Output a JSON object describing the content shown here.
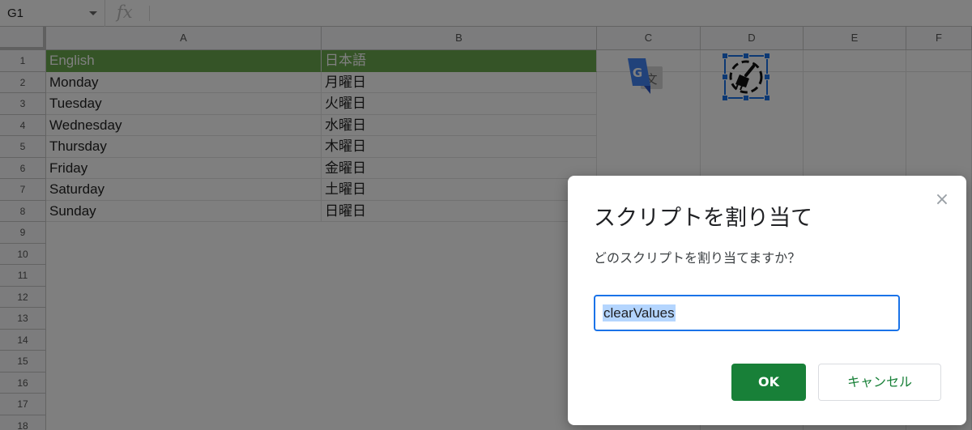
{
  "formula_bar": {
    "cell_ref": "G1",
    "fx_label": "fx",
    "formula": ""
  },
  "columns": [
    "A",
    "B",
    "C",
    "D",
    "E",
    "F"
  ],
  "rows": [
    "1",
    "2",
    "3",
    "4",
    "5",
    "6",
    "7",
    "8",
    "9",
    "10",
    "11",
    "12",
    "13",
    "14",
    "15",
    "16",
    "17",
    "18"
  ],
  "sheet": {
    "header": {
      "a": "English",
      "b": "日本語"
    },
    "data": [
      {
        "a": "Monday",
        "b": "月曜日"
      },
      {
        "a": "Tuesday",
        "b": "火曜日"
      },
      {
        "a": "Wednesday",
        "b": "水曜日"
      },
      {
        "a": "Thursday",
        "b": "木曜日"
      },
      {
        "a": "Friday",
        "b": "金曜日"
      },
      {
        "a": "Saturday",
        "b": "土曜日"
      },
      {
        "a": "Sunday",
        "b": "日曜日"
      }
    ]
  },
  "images": {
    "translate_icon": "google-translate-icon",
    "clean_icon": "broom-cleanup-icon"
  },
  "dialog": {
    "title": "スクリプトを割り当て",
    "question": "どのスクリプトを割り当てますか？",
    "input_value": "clearValues",
    "ok_label": "OK",
    "cancel_label": "キャンセル",
    "close_glyph": "×"
  },
  "colors": {
    "header_fill": "#6aa84f",
    "ok_button": "#188038",
    "focus_blue": "#1a73e8"
  }
}
